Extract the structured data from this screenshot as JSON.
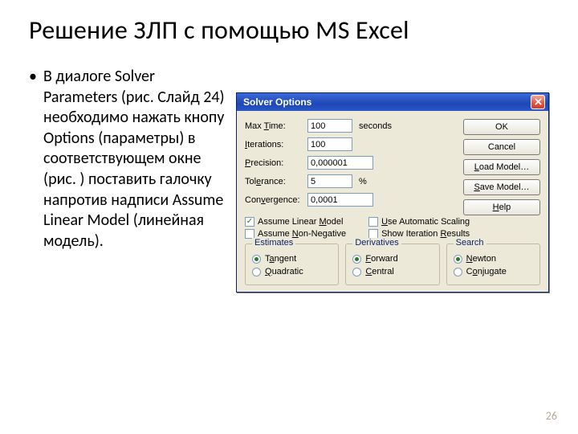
{
  "slide": {
    "title": "Решение ЗЛП с помощью MS Excel",
    "bullet_dot": "•",
    "bullet_text": "В диалоге Solver Parameters (рис. Слайд 24) необходимо нажать кнопу Options (параметры) в соответствующем окне (рис. ) поставить галочку напротив надписи Assume Linear Model (линейная модель).",
    "page_number": "26"
  },
  "dlg": {
    "title": "Solver Options",
    "fields": {
      "max_time": {
        "label_pre": "Max ",
        "ul": "T",
        "label_post": "ime:",
        "value": "100",
        "unit": "seconds"
      },
      "iterations": {
        "label_pre": "",
        "ul": "I",
        "label_post": "terations:",
        "value": "100",
        "unit": ""
      },
      "precision": {
        "label_pre": "",
        "ul": "P",
        "label_post": "recision:",
        "value": "0,000001",
        "unit": ""
      },
      "tolerance": {
        "label_pre": "Tol",
        "ul": "e",
        "label_post": "rance:",
        "value": "5",
        "unit": "%"
      },
      "convergence": {
        "label_pre": "Con",
        "ul": "v",
        "label_post": "ergence:",
        "value": "0,0001",
        "unit": ""
      }
    },
    "buttons": {
      "ok": "OK",
      "cancel": "Cancel",
      "load": {
        "ul": "L",
        "post": "oad Model…"
      },
      "save": {
        "ul": "S",
        "post": "ave Model…"
      },
      "help": {
        "ul": "H",
        "post": "elp"
      }
    },
    "checks": {
      "assume_linear": {
        "pre": "Assume Linear ",
        "ul": "M",
        "post": "odel",
        "checked": true
      },
      "assume_nonneg": {
        "pre": "Assume ",
        "ul": "N",
        "post": "on-Negative",
        "checked": false
      },
      "auto_scale": {
        "ul": "U",
        "post": "se Automatic Scaling",
        "checked": false
      },
      "show_iter": {
        "pre": "Show Iteration ",
        "ul": "R",
        "post": "esults",
        "checked": false
      }
    },
    "groups": {
      "estimates": {
        "legend": "Estimates",
        "opt1": {
          "pre": "T",
          "ul": "a",
          "post": "ngent",
          "selected": true
        },
        "opt2": {
          "ul": "Q",
          "post": "uadratic",
          "selected": false
        }
      },
      "derivatives": {
        "legend": "Derivatives",
        "opt1": {
          "ul": "F",
          "post": "orward",
          "selected": true
        },
        "opt2": {
          "ul": "C",
          "post": "entral",
          "selected": false
        }
      },
      "search": {
        "legend": "Search",
        "opt1": {
          "ul": "N",
          "post": "ewton",
          "selected": true
        },
        "opt2": {
          "pre": "C",
          "ul": "o",
          "post": "njugate",
          "selected": false
        }
      }
    }
  }
}
